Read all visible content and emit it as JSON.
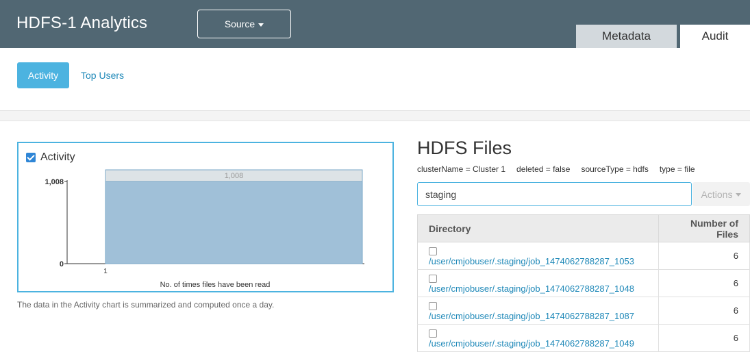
{
  "header": {
    "title": "HDFS-1 Analytics",
    "source_label": "Source",
    "tabs": [
      {
        "label": "Metadata",
        "active": false
      },
      {
        "label": "Audit",
        "active": true
      }
    ]
  },
  "subnav": {
    "activity_label": "Activity",
    "top_users_label": "Top Users"
  },
  "activity_chart": {
    "title": "Activity",
    "checked": true,
    "note": "The data in the Activity chart is summarized and computed once a day."
  },
  "chart_data": {
    "type": "bar",
    "title": "Activity",
    "categories": [
      "1"
    ],
    "values": [
      1008
    ],
    "data_labels": [
      "1,008"
    ],
    "xlabel": "No. of times files have been read",
    "ylabel": "",
    "ylim": [
      0,
      1008
    ],
    "yticks": [
      "0",
      "1,008"
    ],
    "bar_color": "#a0c0d8",
    "label_band_color": "#dde3e6"
  },
  "files": {
    "title": "HDFS Files",
    "filters": [
      "clusterName = Cluster 1",
      "deleted = false",
      "sourceType = hdfs",
      "type = file"
    ],
    "search_value": "staging",
    "actions_label": "Actions",
    "columns": [
      "Directory",
      "Number of Files"
    ],
    "rows": [
      {
        "path": "/user/cmjobuser/.staging/job_1474062788287_1053",
        "count": "6"
      },
      {
        "path": "/user/cmjobuser/.staging/job_1474062788287_1048",
        "count": "6"
      },
      {
        "path": "/user/cmjobuser/.staging/job_1474062788287_1087",
        "count": "6"
      },
      {
        "path": "/user/cmjobuser/.staging/job_1474062788287_1049",
        "count": "6"
      }
    ]
  },
  "colors": {
    "header_bg": "#516773",
    "accent": "#4cb3e0",
    "link": "#1e88b8"
  }
}
